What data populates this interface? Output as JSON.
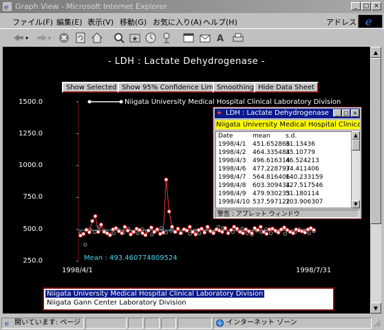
{
  "window": {
    "title": "Graph View - Microsoft Internet Explorer"
  },
  "menu": {
    "items": [
      "ファイル(F)",
      "編集(E)",
      "表示(V)",
      "移動(G)",
      "お気に入り(A)",
      "ヘルプ(H)"
    ],
    "address_label": "アドレス"
  },
  "page": {
    "title": "- LDH : Lactate Dehydrogenase -",
    "buttons": [
      "Show Selected",
      "Show 95% Confidence Limits",
      "Smoothing",
      "Hide Data Sheet"
    ],
    "listbox": [
      "Niigata University Medical Hospital Clinical Laboratory Division",
      "Niigata Gann Center Laboratory Division"
    ]
  },
  "applet": {
    "title": "LDH : Lactate Dehydrogenase",
    "header": "Niigata University Medical Hospital Clinical Laboratory Division",
    "columns": [
      "Date",
      "mean",
      "s.d."
    ],
    "rows": [
      [
        "1998/4/1",
        "451.652866",
        "31.13436"
      ],
      [
        "1998/4/2",
        "464.335484",
        "35.10779"
      ],
      [
        "1998/4/3",
        "496.616314",
        "46.524213"
      ],
      [
        "1998/4/6",
        "477.228797",
        "34.411406"
      ],
      [
        "1998/4/7",
        "564.816406",
        "140.233159"
      ],
      [
        "1998/4/8",
        "603.309434",
        "127.517546"
      ],
      [
        "1998/4/9",
        "479.930233",
        "51.180114"
      ],
      [
        "1998/4/10",
        "537.597122",
        "103.906307"
      ]
    ],
    "status": "警告 : アプレット ウィンドウ"
  },
  "statusbar": {
    "left": "開いています: ページ",
    "zone": "インターネット ゾーン"
  },
  "colors": {
    "series_red": "#ff3030",
    "series_gray": "#9a9a9a",
    "mean_line": "#40c8e0",
    "marker_fill": "#ffffff"
  },
  "chart_data": {
    "type": "line",
    "title": "- LDH : Lactate Dehydrogenase -",
    "ylim": [
      250,
      1500
    ],
    "yticks": [
      "1500.0",
      "1250.0",
      "1000.0",
      "750.0",
      "500.0",
      "250.0"
    ],
    "x_start": "1998/4/1",
    "x_end": "1998/7/31",
    "mean_label": "Mean : 493.460774809524",
    "mean": 493.460774809524,
    "series": [
      {
        "name": "Niigata University Medical Hospital Clinical Laboratory Division",
        "values": [
          451.7,
          464.3,
          496.6,
          477.2,
          564.8,
          603.3,
          479.9,
          537.6,
          480,
          470,
          455,
          500,
          510,
          485,
          470,
          520,
          490,
          460,
          480,
          505,
          495,
          470,
          455,
          490,
          515,
          480,
          500,
          465,
          475,
          890,
          640,
          520,
          480,
          505,
          470,
          500,
          490,
          520,
          480,
          460,
          495,
          505,
          475,
          520,
          485,
          470,
          500,
          490,
          480,
          510,
          470,
          495,
          520,
          505,
          480,
          470,
          500,
          485,
          470,
          510,
          495,
          520,
          480,
          465,
          500,
          505,
          490,
          475,
          500,
          515,
          495,
          480,
          470,
          500,
          490,
          485,
          475,
          500,
          510,
          495
        ]
      },
      {
        "name": "Niigata Gann Center Laboratory Division",
        "values": [
          470,
          380,
          500,
          480,
          520,
          490,
          460,
          470,
          495,
          475,
          505,
          480,
          470,
          500,
          485,
          460,
          495,
          510,
          475,
          490,
          480,
          470,
          500,
          465,
          490,
          470,
          485,
          500,
          475,
          520,
          510,
          470,
          480,
          495,
          505,
          470,
          460,
          490,
          480,
          500,
          470,
          485,
          495,
          465,
          480,
          475,
          500,
          490,
          470,
          485
        ]
      }
    ]
  }
}
